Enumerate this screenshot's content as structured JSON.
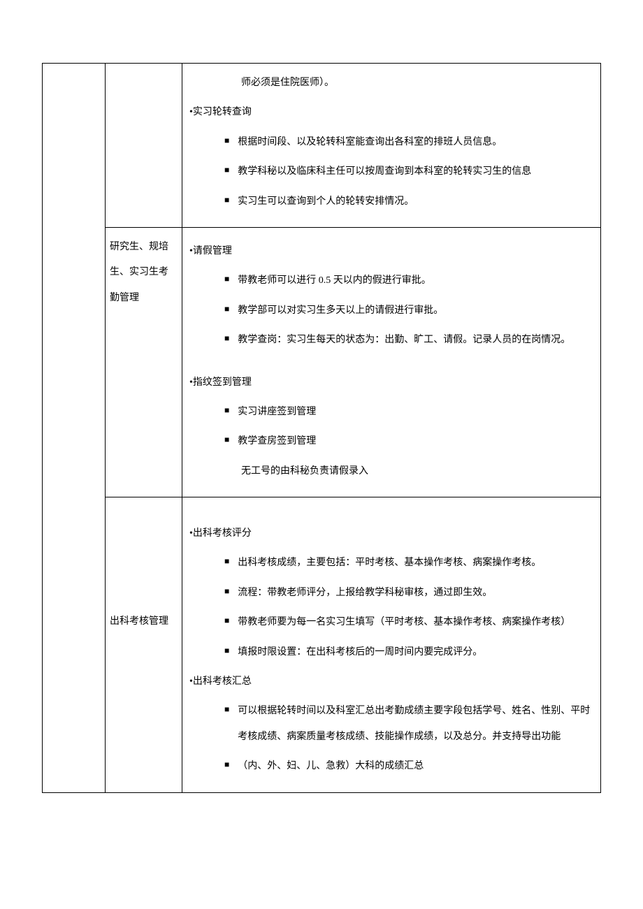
{
  "row1": {
    "col2": "",
    "col3": {
      "continuation": "师必须是住院医师）。",
      "section": "•实习轮转查询",
      "bullets": [
        "根据时间段、以及轮转科室能查询出各科室的排班人员信息。",
        "教学科秘以及临床科主任可以按周查询到本科室的轮转实习生的信息",
        "实习生可以查询到个人的轮转安排情况。"
      ]
    }
  },
  "row2": {
    "col2": "研究生、规培生、实习生考勤管理",
    "col3": {
      "section1": "•请假管理",
      "bullets1": [
        "带教老师可以进行 0.5 天以内的假进行审批。",
        "教学部可以对实习生多天以上的请假进行审批。",
        "教学查岗：实习生每天的状态为：出勤、旷工、请假。记录人员的在岗情况。"
      ],
      "section2": "•指纹签到管理",
      "bullets2": [
        "实习讲座签到管理",
        "教学查房签到管理"
      ],
      "note": "无工号的由科秘负责请假录入"
    }
  },
  "row3": {
    "col2": "出科考核管理",
    "col3": {
      "section1": "•出科考核评分",
      "bullets1": [
        "出科考核成绩，主要包括：平时考核、基本操作考核、病案操作考核。",
        "流程：带教老师评分，上报给教学科秘审核，通过即生效。",
        "带教老师要为每一名实习生填写（平时考核、基本操作考核、病案操作考核）",
        "填报时限设置：在出科考核后的一周时间内要完成评分。"
      ],
      "section2": "•出科考核汇总",
      "bullets2": [
        "可以根据轮转时间以及科室汇总出考勤成绩主要字段包括学号、姓名、性别、平时考核成绩、病案质量考核成绩、技能操作成绩，以及总分。并支持导出功能",
        "（内、外、妇、儿、急救）大科的成绩汇总"
      ]
    }
  }
}
